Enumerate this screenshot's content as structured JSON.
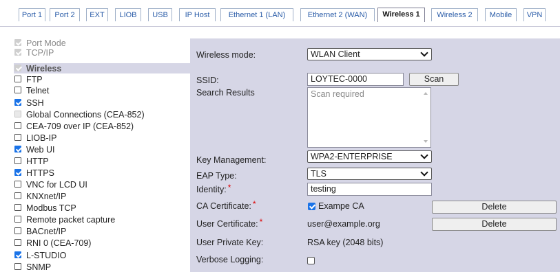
{
  "tabs": [
    {
      "label": "Port 1"
    },
    {
      "label": "Port 2"
    },
    {
      "label": "EXT"
    },
    {
      "label": "LIOB"
    },
    {
      "label": "USB"
    },
    {
      "label": "IP Host"
    },
    {
      "label": "Ethernet 1 (LAN)"
    },
    {
      "label": "Ethernet 2 (WAN)"
    },
    {
      "label": "Wireless 1",
      "active": true
    },
    {
      "label": "Wireless 2"
    },
    {
      "label": "Mobile"
    },
    {
      "label": "VPN"
    }
  ],
  "options": [
    {
      "label": "Port Mode",
      "checked": true,
      "disabled": true
    },
    {
      "label": "TCP/IP",
      "checked": true,
      "disabled": true
    },
    {
      "label": "Wireless",
      "checked": true,
      "disabled": true,
      "selected": true
    },
    {
      "label": "FTP",
      "checked": false
    },
    {
      "label": "Telnet",
      "checked": false
    },
    {
      "label": "SSH",
      "checked": true
    },
    {
      "label": "Global Connections (CEA-852)",
      "checked": false,
      "disabled": true
    },
    {
      "label": "CEA-709 over IP (CEA-852)",
      "checked": false
    },
    {
      "label": "LIOB-IP",
      "checked": false
    },
    {
      "label": "Web UI",
      "checked": true
    },
    {
      "label": "HTTP",
      "checked": false
    },
    {
      "label": "HTTPS",
      "checked": true
    },
    {
      "label": "VNC for LCD UI",
      "checked": false
    },
    {
      "label": "KNXnet/IP",
      "checked": false
    },
    {
      "label": "Modbus TCP",
      "checked": false
    },
    {
      "label": "Remote packet capture",
      "checked": false
    },
    {
      "label": "BACnet/IP",
      "checked": false
    },
    {
      "label": "RNI 0 (CEA-709)",
      "checked": false
    },
    {
      "label": "L-STUDIO",
      "checked": true
    },
    {
      "label": "SNMP",
      "checked": false
    }
  ],
  "form": {
    "wireless_mode_label": "Wireless mode:",
    "wireless_mode_value": "WLAN Client",
    "ssid_label": "SSID:",
    "ssid_value": "LOYTEC-0000",
    "scan_button": "Scan",
    "search_results_label": "Search Results",
    "search_results_placeholder": "Scan required",
    "key_mgmt_label": "Key Management:",
    "key_mgmt_value": "WPA2-ENTERPRISE",
    "eap_type_label": "EAP Type:",
    "eap_type_value": "TLS",
    "identity_label": "Identity:",
    "identity_value": "testing",
    "ca_cert_label": "CA Certificate:",
    "ca_cert_value": "Exampe CA",
    "ca_cert_checked": true,
    "ca_delete_button": "Delete",
    "user_cert_label": "User Certificate:",
    "user_cert_value": "user@example.org",
    "user_delete_button": "Delete",
    "user_private_key_label": "User Private Key:",
    "user_private_key_value": "RSA key (2048 bits)",
    "verbose_logging_label": "Verbose Logging:",
    "verbose_logging_checked": false,
    "required_marker": "*"
  }
}
